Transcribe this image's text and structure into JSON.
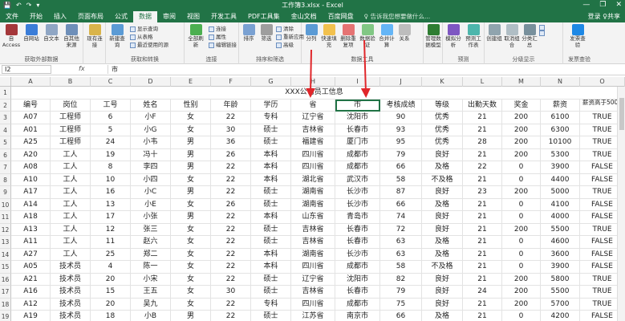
{
  "window": {
    "title": "工作簿3.xlsx - Excel",
    "quick_access": [
      "💾",
      "↶",
      "↷",
      "▾"
    ],
    "controls": [
      "—",
      "❐",
      "✕"
    ]
  },
  "tabs": [
    {
      "label": "文件"
    },
    {
      "label": "开始"
    },
    {
      "label": "插入"
    },
    {
      "label": "页面布局"
    },
    {
      "label": "公式"
    },
    {
      "label": "数据"
    },
    {
      "label": "审阅"
    },
    {
      "label": "视图"
    },
    {
      "label": "开发工具"
    },
    {
      "label": "PDF工具集"
    },
    {
      "label": "金山文档"
    },
    {
      "label": "百度网盘"
    }
  ],
  "tell_me": "♀ 告诉我您想要做什么...",
  "share": "登录 ♀共享",
  "ribbon": {
    "groups": {
      "get_external": "获取外部数据",
      "get_transform": "获取和转换",
      "connections": "连接",
      "sort_filter": "排序和筛选",
      "data_tools": "数据工具",
      "forecast": "预测",
      "outline": "分级显示",
      "check": "发票查验"
    },
    "buttons": {
      "access": "自 Access",
      "web": "自网站",
      "text": "自文本",
      "other": "自其他来源",
      "existing": "现有连接",
      "new_query": "新建查询",
      "refresh_all": "全部刷新",
      "sort": "排序",
      "filter": "筛选",
      "split": "分列",
      "flash_fill": "快速填充",
      "remove_dup": "删除重复项",
      "validate": "数据验证",
      "consolidate": "合并计算",
      "relations": "关系",
      "model": "管理数据模型",
      "whatif": "模拟分析",
      "forecast_sheet": "预测工作表",
      "group": "创建组",
      "ungroup": "取消组合",
      "subtotal": "分类汇总",
      "invoice": "发票查验"
    },
    "small": {
      "show_query": "显示查询",
      "from_table": "从表格",
      "recent": "最近使用的源",
      "connections": "连接",
      "properties": "属性",
      "edit_links": "编辑链接",
      "clear": "清除",
      "reapply": "重新应用",
      "advanced": "高级",
      "show_detail": "显示明细数据",
      "hide_detail": "隐藏明细数据"
    }
  },
  "formula_bar": {
    "name_box": "I2",
    "fx": "fx",
    "content": "市"
  },
  "columns": [
    "A",
    "B",
    "C",
    "D",
    "E",
    "F",
    "G",
    "H",
    "I",
    "J",
    "K",
    "L",
    "M",
    "N",
    "O"
  ],
  "sheet_title": "XXX公司员工信息",
  "headers": [
    "编号",
    "岗位",
    "工号",
    "姓名",
    "性别",
    "年龄",
    "学历",
    "省",
    "市",
    "考核成绩",
    "等级",
    "出勤天数",
    "奖金",
    "薪资",
    "薪资高于5000"
  ],
  "rows": [
    [
      "A07",
      "工程师",
      "6",
      "小F",
      "女",
      "22",
      "专科",
      "辽宁省",
      "沈阳市",
      "90",
      "优秀",
      "21",
      "200",
      "6100",
      "TRUE"
    ],
    [
      "A01",
      "工程师",
      "5",
      "小G",
      "女",
      "30",
      "硕士",
      "吉林省",
      "长春市",
      "93",
      "优秀",
      "21",
      "200",
      "6300",
      "TRUE"
    ],
    [
      "A25",
      "工程师",
      "24",
      "小韦",
      "男",
      "36",
      "硕士",
      "福建省",
      "厦门市",
      "95",
      "优秀",
      "28",
      "200",
      "10100",
      "TRUE"
    ],
    [
      "A20",
      "工人",
      "19",
      "冯十",
      "男",
      "26",
      "本科",
      "四川省",
      "成都市",
      "79",
      "良好",
      "21",
      "200",
      "5300",
      "TRUE"
    ],
    [
      "A08",
      "工人",
      "8",
      "李四",
      "男",
      "22",
      "本科",
      "四川省",
      "成都市",
      "66",
      "及格",
      "22",
      "0",
      "3900",
      "FALSE"
    ],
    [
      "A10",
      "工人",
      "10",
      "小四",
      "女",
      "22",
      "本科",
      "湖北省",
      "武汉市",
      "58",
      "不及格",
      "21",
      "0",
      "4400",
      "FALSE"
    ],
    [
      "A17",
      "工人",
      "16",
      "小C",
      "男",
      "22",
      "硕士",
      "湖南省",
      "长沙市",
      "87",
      "良好",
      "23",
      "200",
      "5000",
      "TRUE"
    ],
    [
      "A14",
      "工人",
      "13",
      "小E",
      "女",
      "26",
      "硕士",
      "湖南省",
      "长沙市",
      "66",
      "及格",
      "21",
      "0",
      "4100",
      "FALSE"
    ],
    [
      "A18",
      "工人",
      "17",
      "小张",
      "男",
      "22",
      "本科",
      "山东省",
      "青岛市",
      "74",
      "良好",
      "21",
      "0",
      "4000",
      "FALSE"
    ],
    [
      "A13",
      "工人",
      "12",
      "张三",
      "女",
      "22",
      "硕士",
      "吉林省",
      "长春市",
      "72",
      "良好",
      "21",
      "200",
      "5500",
      "TRUE"
    ],
    [
      "A11",
      "工人",
      "11",
      "赵六",
      "女",
      "22",
      "硕士",
      "吉林省",
      "长春市",
      "63",
      "及格",
      "21",
      "0",
      "4600",
      "FALSE"
    ],
    [
      "A27",
      "工人",
      "25",
      "郑二",
      "女",
      "22",
      "本科",
      "湖南省",
      "长沙市",
      "63",
      "及格",
      "21",
      "0",
      "3600",
      "FALSE"
    ],
    [
      "A05",
      "技术员",
      "4",
      "陈一",
      "女",
      "22",
      "本科",
      "四川省",
      "成都市",
      "58",
      "不及格",
      "21",
      "0",
      "3900",
      "FALSE"
    ],
    [
      "A21",
      "技术员",
      "20",
      "小宋",
      "女",
      "22",
      "硕士",
      "辽宁省",
      "沈阳市",
      "82",
      "良好",
      "21",
      "200",
      "5800",
      "TRUE"
    ],
    [
      "A16",
      "技术员",
      "15",
      "王五",
      "女",
      "30",
      "硕士",
      "吉林省",
      "长春市",
      "79",
      "良好",
      "24",
      "200",
      "5500",
      "TRUE"
    ],
    [
      "A12",
      "技术员",
      "20",
      "吴九",
      "女",
      "22",
      "专科",
      "四川省",
      "成都市",
      "75",
      "良好",
      "21",
      "200",
      "5700",
      "TRUE"
    ],
    [
      "A19",
      "技术员",
      "18",
      "小B",
      "男",
      "22",
      "硕士",
      "江苏省",
      "南京市",
      "66",
      "及格",
      "21",
      "0",
      "4200",
      "FALSE"
    ],
    [
      "A15",
      "技术员",
      "14",
      "小D",
      "女",
      "22",
      "本科",
      "江苏省",
      "南京市",
      "58",
      "不及格",
      "23",
      "0",
      "3900",
      "FALSE"
    ]
  ]
}
